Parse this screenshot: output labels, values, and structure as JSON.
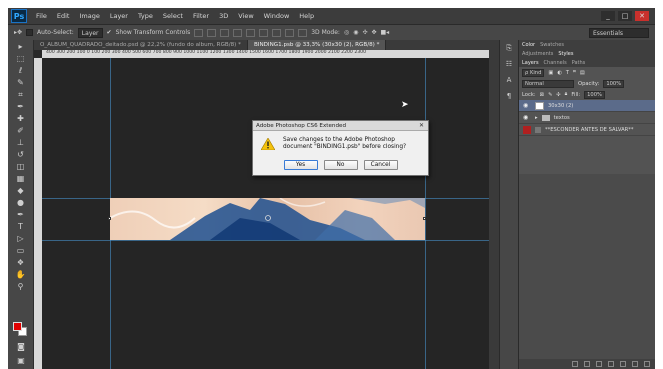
{
  "app": {
    "logo": "Ps"
  },
  "menu": [
    "File",
    "Edit",
    "Image",
    "Layer",
    "Type",
    "Select",
    "Filter",
    "3D",
    "View",
    "Window",
    "Help"
  ],
  "window_controls": {
    "minimize": "_",
    "restore": "□",
    "close": "✕"
  },
  "options_bar": {
    "auto_select_label": "Auto-Select:",
    "auto_select_value": "Layer",
    "show_transform_label": "Show Transform Controls",
    "mode_3d_label": "3D Mode:",
    "workspace": "Essentials"
  },
  "tabs": [
    {
      "label": "O_ALBUM_QUADRADO_deitado.psd @ 22,2% (fundo do album, RGB/8) *"
    },
    {
      "label": "BINDING1.psb @ 33,3% (30x30 (2), RGB/8) *"
    }
  ],
  "ruler_ticks": "400  300  200  100  0   100  200  300  400  500  600  700  800  900  1000 1100 1200 1300 1400 1500 1600 1700 1800 1900 2000 2100 2200 2300",
  "dialog": {
    "title": "Adobe Photoshop CS6 Extended",
    "message": "Save changes to the Adobe Photoshop document \"BINDING1.psb\" before closing?",
    "buttons": {
      "yes": "Yes",
      "no": "No",
      "cancel": "Cancel"
    }
  },
  "panels": {
    "color_tabs": [
      "Color",
      "Swatches"
    ],
    "adjust_tabs": [
      "Adjustments",
      "Styles"
    ],
    "layer_tabs": [
      "Layers",
      "Channels",
      "Paths"
    ],
    "kind_label": "ρ Kind",
    "blend_mode": "Normal",
    "opacity_label": "Opacity:",
    "opacity_value": "100%",
    "lock_label": "Lock:",
    "fill_label": "Fill:",
    "fill_value": "100%",
    "layers": [
      {
        "name": "30x30 (2)",
        "selected": true,
        "type": "smart"
      },
      {
        "name": "textos",
        "selected": false,
        "type": "group"
      },
      {
        "name": "**ESCONDER ANTES DE SALVAR**",
        "selected": false,
        "type": "red"
      }
    ]
  },
  "colors": {
    "foreground": "#e00000",
    "background": "#ffffff"
  }
}
